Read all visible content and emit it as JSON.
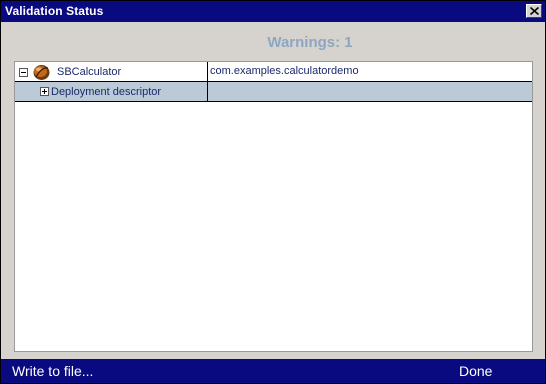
{
  "window": {
    "title": "Validation Status"
  },
  "summary": {
    "warnings_text": "Warnings: 1"
  },
  "tree": {
    "rows": [
      {
        "label": "SBCalculator",
        "value": "com.examples.calculatordemo",
        "expanded": true,
        "icon": "bean-icon"
      },
      {
        "label": "Deployment descriptor",
        "value": "",
        "expanded": false
      }
    ]
  },
  "footer": {
    "write_label": "Write to file...",
    "done_label": "Done"
  },
  "colors": {
    "titlebar": "#0a0a80",
    "warning_text": "#8ea6c2",
    "selected_row": "#bccad8",
    "dialog_bg": "#d6d3ce"
  }
}
